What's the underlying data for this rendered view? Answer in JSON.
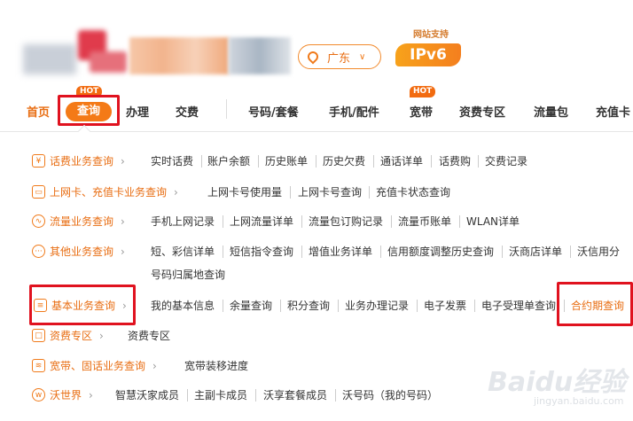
{
  "header": {
    "city": "广东",
    "ipv6_caption": "网站支持",
    "ipv6_label": "IPv6"
  },
  "nav": {
    "hot_label": "HOT",
    "items": [
      "首页",
      "查询",
      "办理",
      "交费",
      "号码/套餐",
      "手机/配件",
      "宽带",
      "资费专区",
      "流量包",
      "充值卡"
    ]
  },
  "menu": [
    {
      "category": "话费业务查询",
      "links": [
        "实时话费",
        "账户余额",
        "历史账单",
        "历史欠费",
        "通话详单",
        "话费购",
        "交费记录"
      ]
    },
    {
      "category": "上网卡、充值卡业务查询",
      "links": [
        "上网卡号使用量",
        "上网卡号查询",
        "充值卡状态查询"
      ]
    },
    {
      "category": "流量业务查询",
      "links": [
        "手机上网记录",
        "上网流量详单",
        "流量包订购记录",
        "流量币账单",
        "WLAN详单"
      ]
    },
    {
      "category": "其他业务查询",
      "links": [
        "短、彩信详单",
        "短信指令查询",
        "增值业务详单",
        "信用额度调整历史查询",
        "沃商店详单",
        "沃信用分",
        "号码归属地查询"
      ]
    },
    {
      "category": "基本业务查询",
      "links": [
        "我的基本信息",
        "余量查询",
        "积分查询",
        "业务办理记录",
        "电子发票",
        "电子受理单查询",
        "合约期查询"
      ]
    },
    {
      "category": "资费专区",
      "links": [
        "资费专区"
      ]
    },
    {
      "category": "宽带、固话业务查询",
      "links": [
        "宽带装移进度"
      ]
    },
    {
      "category": "沃世界",
      "links": [
        "智慧沃家成员",
        "主副卡成员",
        "沃享套餐成员",
        "沃号码（我的号码）"
      ]
    }
  ],
  "watermark": {
    "text": "Baidu经验",
    "sub": "jingyan.baidu.com"
  },
  "colors": {
    "accent": "#f47a17",
    "highlight_box": "#e0121f"
  }
}
